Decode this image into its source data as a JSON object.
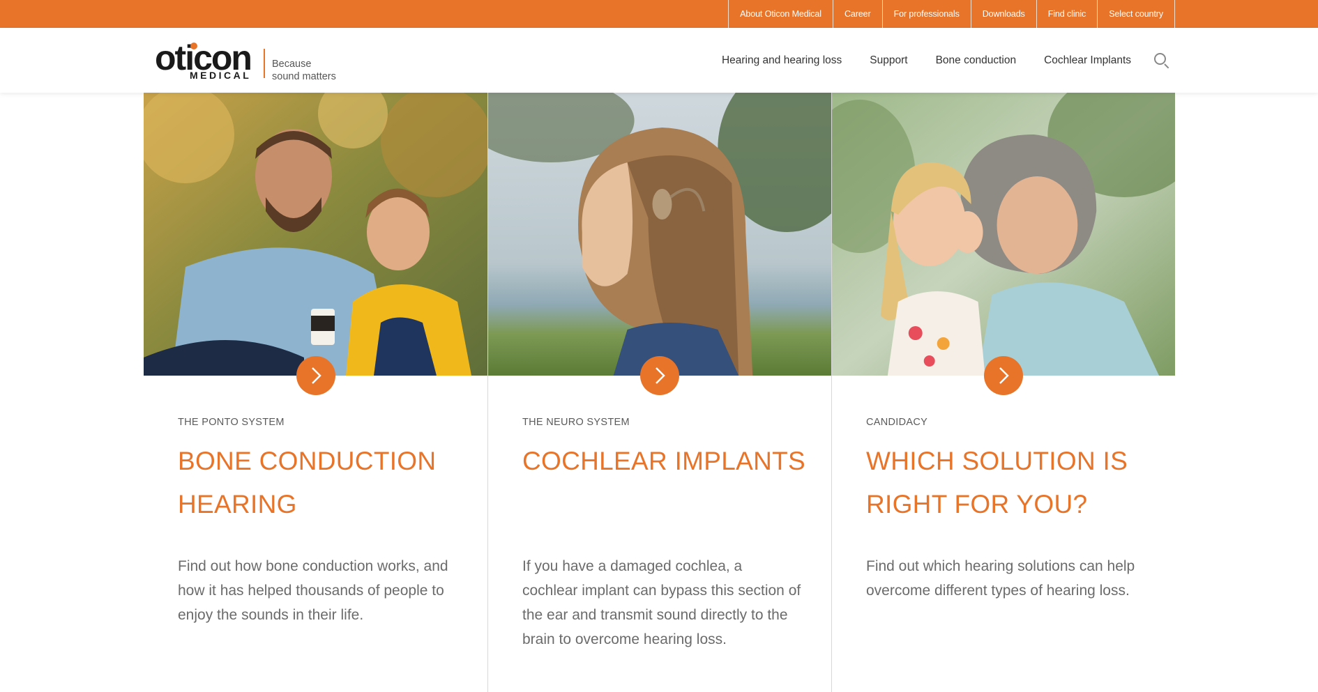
{
  "utility_nav": {
    "items": [
      {
        "label": "About Oticon Medical"
      },
      {
        "label": "Career"
      },
      {
        "label": "For professionals"
      },
      {
        "label": "Downloads"
      },
      {
        "label": "Find clinic"
      },
      {
        "label": "Select country"
      }
    ]
  },
  "brand": {
    "name": "oticon",
    "sub": "MEDICAL",
    "tagline_line1": "Because",
    "tagline_line2": "sound matters"
  },
  "main_nav": {
    "items": [
      {
        "label": "Hearing and hearing loss"
      },
      {
        "label": "Support"
      },
      {
        "label": "Bone conduction"
      },
      {
        "label": "Cochlear Implants"
      }
    ],
    "search_icon": "search-icon"
  },
  "cards": [
    {
      "eyebrow": "THE PONTO SYSTEM",
      "title": "BONE CONDUCTION HEARING",
      "text": "Find out how bone conduction works, and how it has helped thousands of people to enjoy the sounds in their life.",
      "icon": "chevron-right-icon"
    },
    {
      "eyebrow": "THE NEURO SYSTEM",
      "title": "COCHLEAR IMPLANTS",
      "text": "If you have a damaged cochlea, a cochlear implant can bypass this section of the ear and transmit sound directly to the brain to overcome hearing loss.",
      "icon": "chevron-right-icon"
    },
    {
      "eyebrow": "CANDIDACY",
      "title": "WHICH SOLUTION IS RIGHT FOR YOU?",
      "text": "Find out which hearing solutions can help overcome different types of hearing loss.",
      "icon": "chevron-right-icon"
    }
  ],
  "colors": {
    "accent": "#e8742a",
    "text": "#6b6b6b"
  }
}
